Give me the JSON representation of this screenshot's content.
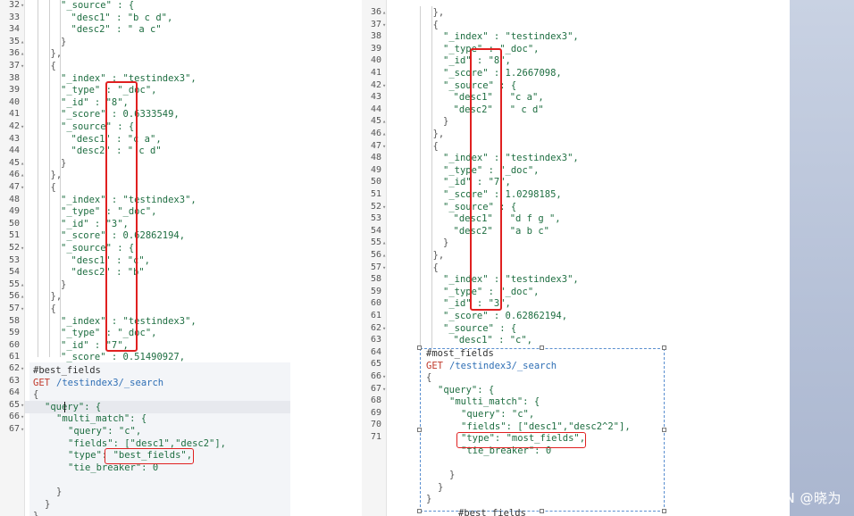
{
  "left_result": {
    "rows": [
      {
        "ln": "32",
        "fold": "down",
        "indent": 2,
        "text": "\"_source\" : {",
        "t": "code"
      },
      {
        "ln": "33",
        "indent": 3,
        "text": "\"desc1\" : \"b c d\",",
        "t": "code"
      },
      {
        "ln": "34",
        "indent": 3,
        "text": "\"desc2\" : \" a c\"",
        "t": "code"
      },
      {
        "ln": "35",
        "fold": "up",
        "indent": 2,
        "text": "}",
        "t": "punct"
      },
      {
        "ln": "36",
        "fold": "up",
        "indent": 1,
        "text": "},",
        "t": "punct"
      },
      {
        "ln": "37",
        "fold": "down",
        "indent": 1,
        "text": "{",
        "t": "punct"
      },
      {
        "ln": "38",
        "indent": 2,
        "text": "\"_index\" : \"testindex3\",",
        "t": "code"
      },
      {
        "ln": "39",
        "indent": 2,
        "text": "\"_type\" : \"_doc\",",
        "t": "code"
      },
      {
        "ln": "40",
        "indent": 2,
        "text": "\"_id\" : \"8\",",
        "t": "code"
      },
      {
        "ln": "41",
        "indent": 2,
        "text": "\"_score\" : 0.6333549,",
        "t": "code"
      },
      {
        "ln": "42",
        "fold": "down",
        "indent": 2,
        "text": "\"_source\" : {",
        "t": "code"
      },
      {
        "ln": "43",
        "indent": 3,
        "text": "\"desc1\" : \"c a\",",
        "t": "code"
      },
      {
        "ln": "44",
        "indent": 3,
        "text": "\"desc2\" : \" c d\"",
        "t": "code"
      },
      {
        "ln": "45",
        "fold": "up",
        "indent": 2,
        "text": "}",
        "t": "punct"
      },
      {
        "ln": "46",
        "fold": "up",
        "indent": 1,
        "text": "},",
        "t": "punct"
      },
      {
        "ln": "47",
        "fold": "down",
        "indent": 1,
        "text": "{",
        "t": "punct"
      },
      {
        "ln": "48",
        "indent": 2,
        "text": "\"_index\" : \"testindex3\",",
        "t": "code"
      },
      {
        "ln": "49",
        "indent": 2,
        "text": "\"_type\" : \"_doc\",",
        "t": "code"
      },
      {
        "ln": "50",
        "indent": 2,
        "text": "\"_id\" : \"3\",",
        "t": "code"
      },
      {
        "ln": "51",
        "indent": 2,
        "text": "\"_score\" : 0.62862194,",
        "t": "code"
      },
      {
        "ln": "52",
        "fold": "down",
        "indent": 2,
        "text": "\"_source\" : {",
        "t": "code"
      },
      {
        "ln": "53",
        "indent": 3,
        "text": "\"desc1\" : \"c\",",
        "t": "code"
      },
      {
        "ln": "54",
        "indent": 3,
        "text": "\"desc2\" : \"b\"",
        "t": "code"
      },
      {
        "ln": "55",
        "fold": "up",
        "indent": 2,
        "text": "}",
        "t": "punct"
      },
      {
        "ln": "56",
        "fold": "up",
        "indent": 1,
        "text": "},",
        "t": "punct"
      },
      {
        "ln": "57",
        "fold": "down",
        "indent": 1,
        "text": "{",
        "t": "punct"
      },
      {
        "ln": "58",
        "indent": 2,
        "text": "\"_index\" : \"testindex3\",",
        "t": "code"
      },
      {
        "ln": "59",
        "indent": 2,
        "text": "\"_type\" : \"_doc\",",
        "t": "code"
      },
      {
        "ln": "60",
        "indent": 2,
        "text": "\"_id\" : \"7\",",
        "t": "code"
      },
      {
        "ln": "61",
        "indent": 2,
        "text": "\"_score\" : 0.51490927,",
        "t": "code"
      }
    ]
  },
  "left_query": {
    "gutter_lines": [
      {
        "ln": "62",
        "fold": "down"
      },
      {
        "ln": "63"
      },
      {
        "ln": "64"
      },
      {
        "ln": "65",
        "fold": "down"
      },
      {
        "ln": "66",
        "fold": "down"
      },
      {
        "ln": "67",
        "fold": "down"
      }
    ],
    "comment": "#best_fields",
    "method": "GET",
    "url": "/testindex3/_search",
    "lines": [
      {
        "indent": 0,
        "text": "{",
        "t": "punct"
      },
      {
        "indent": 1,
        "text": "\"query\": {",
        "t": "code"
      },
      {
        "indent": 2,
        "text": "\"multi_match\": {",
        "t": "code"
      },
      {
        "indent": 3,
        "text": "\"query\": \"c\",",
        "t": "code"
      },
      {
        "indent": 3,
        "text": "\"fields\": [\"desc1\",\"desc2\"],",
        "t": "code"
      },
      {
        "indent": 3,
        "text": "\"type\": \"best_fields\",",
        "t": "code"
      },
      {
        "indent": 3,
        "text": "\"tie_breaker\": 0",
        "t": "code"
      },
      {
        "indent": 2,
        "text": "",
        "t": "punct"
      },
      {
        "indent": 2,
        "text": "}",
        "t": "punct"
      },
      {
        "indent": 1,
        "text": "}",
        "t": "punct"
      },
      {
        "indent": 0,
        "text": "}",
        "t": "punct"
      }
    ]
  },
  "right_result": {
    "rows": [
      {
        "ln": "36",
        "fold": "up",
        "indent": 1,
        "text": "},",
        "t": "punct"
      },
      {
        "ln": "37",
        "fold": "down",
        "indent": 1,
        "text": "{",
        "t": "punct"
      },
      {
        "ln": "38",
        "indent": 2,
        "text": "\"_index\" : \"testindex3\",",
        "t": "code"
      },
      {
        "ln": "39",
        "indent": 2,
        "text": "\"_type\" : \"_doc\",",
        "t": "code"
      },
      {
        "ln": "40",
        "indent": 2,
        "text": "\"_id\" : \"8\",",
        "t": "code"
      },
      {
        "ln": "41",
        "indent": 2,
        "text": "\"_score\" : 1.2667098,",
        "t": "code"
      },
      {
        "ln": "42",
        "fold": "down",
        "indent": 2,
        "text": "\"_source\" : {",
        "t": "code"
      },
      {
        "ln": "43",
        "indent": 3,
        "text": "\"desc1\" : \"c a\",",
        "t": "code"
      },
      {
        "ln": "44",
        "indent": 3,
        "text": "\"desc2\" : \" c d\"",
        "t": "code"
      },
      {
        "ln": "45",
        "fold": "up",
        "indent": 2,
        "text": "}",
        "t": "punct"
      },
      {
        "ln": "46",
        "fold": "up",
        "indent": 1,
        "text": "},",
        "t": "punct"
      },
      {
        "ln": "47",
        "fold": "down",
        "indent": 1,
        "text": "{",
        "t": "punct"
      },
      {
        "ln": "48",
        "indent": 2,
        "text": "\"_index\" : \"testindex3\",",
        "t": "code"
      },
      {
        "ln": "49",
        "indent": 2,
        "text": "\"_type\" : \"_doc\",",
        "t": "code"
      },
      {
        "ln": "50",
        "indent": 2,
        "text": "\"_id\" : \"7\",",
        "t": "code"
      },
      {
        "ln": "51",
        "indent": 2,
        "text": "\"_score\" : 1.0298185,",
        "t": "code"
      },
      {
        "ln": "52",
        "fold": "down",
        "indent": 2,
        "text": "\"_source\" : {",
        "t": "code"
      },
      {
        "ln": "53",
        "indent": 3,
        "text": "\"desc1\" : \"d f g \",",
        "t": "code"
      },
      {
        "ln": "54",
        "indent": 3,
        "text": "\"desc2\" : \"a b c\"",
        "t": "code"
      },
      {
        "ln": "55",
        "fold": "up",
        "indent": 2,
        "text": "}",
        "t": "punct"
      },
      {
        "ln": "56",
        "fold": "up",
        "indent": 1,
        "text": "},",
        "t": "punct"
      },
      {
        "ln": "57",
        "fold": "down",
        "indent": 1,
        "text": "{",
        "t": "punct"
      },
      {
        "ln": "58",
        "indent": 2,
        "text": "\"_index\" : \"testindex3\",",
        "t": "code"
      },
      {
        "ln": "59",
        "indent": 2,
        "text": "\"_type\" : \"_doc\",",
        "t": "code"
      },
      {
        "ln": "60",
        "indent": 2,
        "text": "\"_id\" : \"3\",",
        "t": "code"
      },
      {
        "ln": "61",
        "indent": 2,
        "text": "\"_score\" : 0.62862194,",
        "t": "code"
      },
      {
        "ln": "62",
        "fold": "down",
        "indent": 2,
        "text": "\"_source\" : {",
        "t": "code"
      },
      {
        "ln": "63",
        "indent": 3,
        "text": "\"desc1\" : \"c\",",
        "t": "code"
      },
      {
        "ln": "64",
        "indent": 0,
        "text": "",
        "t": "punct"
      },
      {
        "ln": "65",
        "indent": 0,
        "text": "",
        "t": "punct"
      },
      {
        "ln": "66",
        "fold": "down",
        "indent": 0,
        "text": "",
        "t": "punct"
      },
      {
        "ln": "67",
        "fold": "down",
        "indent": 0,
        "text": "",
        "t": "punct"
      },
      {
        "ln": "68",
        "indent": 0,
        "text": "",
        "t": "punct"
      },
      {
        "ln": "69",
        "indent": 0,
        "text": "",
        "t": "punct"
      },
      {
        "ln": "70",
        "indent": 0,
        "text": "",
        "t": "punct"
      },
      {
        "ln": "71",
        "indent": 0,
        "text": "",
        "t": "punct"
      }
    ]
  },
  "right_query": {
    "comment": "#most_fields",
    "method": "GET",
    "url": "/testindex3/_search",
    "lines": [
      {
        "indent": 0,
        "text": "{",
        "t": "punct"
      },
      {
        "indent": 1,
        "text": "\"query\": {",
        "t": "code"
      },
      {
        "indent": 2,
        "text": "\"multi_match\": {",
        "t": "code"
      },
      {
        "indent": 3,
        "text": "\"query\": \"c\",",
        "t": "code"
      },
      {
        "indent": 3,
        "text": "\"fields\": [\"desc1\",\"desc2^2\"],",
        "t": "code"
      },
      {
        "indent": 3,
        "text": "\"type\": \"most_fields\",",
        "t": "code"
      },
      {
        "indent": 3,
        "text": "\"tie_breaker\": 0",
        "t": "code"
      },
      {
        "indent": 2,
        "text": "",
        "t": "punct"
      },
      {
        "indent": 2,
        "text": "}",
        "t": "punct"
      },
      {
        "indent": 1,
        "text": "}",
        "t": "punct"
      },
      {
        "indent": 0,
        "text": "}",
        "t": "punct"
      }
    ],
    "cut_off_line": "#best_fields"
  },
  "watermark": "CSDN @晓为",
  "colors": {
    "json_value": "#1e6e41",
    "method": "#c0392b",
    "url": "#2f6fb5",
    "highlight_border": "#e02020",
    "selection_border": "#5a8fd0"
  }
}
